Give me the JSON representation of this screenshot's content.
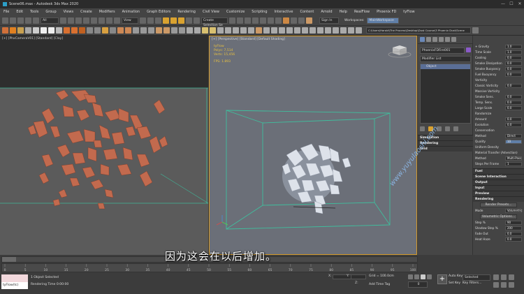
{
  "window": {
    "title": "Scene06.max - Autodesk 3ds Max 2020",
    "minimize": "—",
    "maximize": "☐",
    "close": "✕"
  },
  "menu": [
    "File",
    "Edit",
    "Tools",
    "Group",
    "Views",
    "Create",
    "Modifiers",
    "Animation",
    "Graph Editors",
    "Rendering",
    "Civil View",
    "Customize",
    "Scripting",
    "Interactive",
    "Content",
    "Arnold",
    "Help",
    "RealFlow",
    "Phoenix FD",
    "tyFlow"
  ],
  "toolbar": {
    "selection_filter": "All",
    "view_dropdown": "View",
    "selection_set": "Create Selection Se",
    "signin": "Sign In",
    "workspaces_label": "Workspaces:",
    "workspace": "MainWorkspace",
    "path": "C:\\Users\\Harold\\The Process\\Desktop\\Dust Course\\3 Phoenix Dust\\Scene"
  },
  "left_viewport": {
    "label": "[+] [PhxCameraV01] [Standard] [Clay]"
  },
  "right_viewport": {
    "label": "[+] [Perspective] [Standard] [Default Shading]",
    "stats": {
      "title": "tyFlow",
      "polys_label": "Polys:",
      "polys": "7,514",
      "verts_label": "Verts:",
      "verts": "15,456",
      "fps_label": "FPS:",
      "fps": "1.893"
    }
  },
  "command_panel": {
    "object_name": "PhoenixFDFire001",
    "modifier_list": "Modifier List",
    "stack_item": "Object",
    "rollouts": [
      "Simulation",
      "Rendering",
      "Grid"
    ],
    "params": [
      {
        "label": "+ Gravity",
        "value": "1.0"
      },
      {
        "label": "Time Scale",
        "value": "1.0"
      },
      {
        "label": "Cooling",
        "value": "0.0"
      },
      {
        "label": "Smoke Dissipation",
        "value": "0.0"
      },
      {
        "label": "Smoke Buoyancy",
        "value": "0.0"
      },
      {
        "label": "Fuel Buoyancy",
        "value": "0.0"
      },
      {
        "label": "Vorticity",
        "value": ""
      },
      {
        "label": "Classic Vorticity",
        "value": "0.0"
      },
      {
        "label": "Massive Vorticity",
        "value": ""
      },
      {
        "label": "Smoke Sens.",
        "value": "0.0"
      },
      {
        "label": "Temp. Sens.",
        "value": "0.0"
      },
      {
        "label": "Large Scale",
        "value": "0.0"
      },
      {
        "label": "Randomize",
        "value": ""
      },
      {
        "label": "Amount",
        "value": "0.0"
      },
      {
        "label": "Evolution",
        "value": "0.0"
      },
      {
        "label": "Conservation",
        "value": ""
      },
      {
        "label": "Method",
        "value": "Direct"
      },
      {
        "label": "Quality",
        "value": "10"
      },
      {
        "label": "Uniform Density",
        "value": ""
      },
      {
        "label": "Material Transfer (Advection)",
        "value": ""
      },
      {
        "label": "Method",
        "value": "Multi-Pass"
      },
      {
        "label": "Steps Per Frame",
        "value": "1"
      }
    ],
    "sections": [
      "Fuel",
      "Scene Interaction",
      "Output",
      "Input",
      "Preview",
      "Rendering"
    ],
    "render_params": [
      {
        "label": "Render Presets..."
      },
      {
        "label": "Mode",
        "value": "Volumetric"
      },
      {
        "label": "Volumetric Options..."
      },
      {
        "label": "Step %",
        "value": "90"
      },
      {
        "label": "Shadow Step %",
        "value": "200"
      },
      {
        "label": "Fade Out",
        "value": "0.0"
      },
      {
        "label": "Heat Haze",
        "value": "0.0"
      }
    ]
  },
  "bottom": {
    "script_listener": "tyFlow(tc)",
    "status": "1 Object Selected",
    "render_time": "Rendering Time 0:00:00",
    "x_label": "X:",
    "y_label": "Y:",
    "z_label": "Z:",
    "grid": "Grid = 100.0cm",
    "add_time_tag": "Add Time Tag",
    "autokey": "Auto Key",
    "selected": "Selected",
    "set_key": "Set Key",
    "key_filters": "Key Filters...",
    "frame": "0"
  },
  "timeline_ticks": [
    "0",
    "5",
    "10",
    "15",
    "20",
    "25",
    "30",
    "35",
    "40",
    "45",
    "50",
    "55",
    "60",
    "65",
    "70",
    "75",
    "80",
    "85",
    "90",
    "95",
    "100"
  ],
  "subtitle": "因为这会在以后增加。",
  "watermark": "www.yuyulaoshi.com"
}
